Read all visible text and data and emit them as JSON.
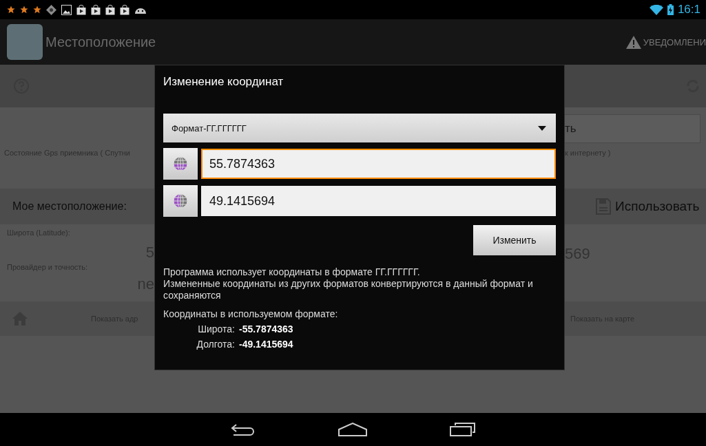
{
  "status_bar": {
    "time": "16:1"
  },
  "action_bar": {
    "title": "Местоположение",
    "notice": "УВЕДОМЛЕНИ"
  },
  "background": {
    "button_fragment": "ть",
    "gps_status_left": "Состояние Gps приемника ( Спутни",
    "gps_status_right": "к интернету )",
    "section_title": "Мое местоположение:",
    "use_button": "Использовать",
    "latitude_label": "Широта (Latitude):",
    "latitude_fragment": "5",
    "longitude_fragment": "569",
    "provider_label": "Провайдер и точность:",
    "provider_fragment": "ne",
    "show_address": "Показать адр",
    "show_on_map": "Показать на карте"
  },
  "dialog": {
    "title": "Изменение координат",
    "format_select": {
      "value": "Формат-ГГ.ГГГГГГ"
    },
    "fields": [
      {
        "value": "55.7874363",
        "focused": true
      },
      {
        "value": "49.1415694",
        "focused": false
      }
    ],
    "apply_button": "Изменить",
    "description": "Программа использует координаты в формате ГГ.ГГГГГГ.\nИзмененные координаты из других форматов конвертируются в данный формат и сохраняются",
    "format_label": "Координаты в используемом формате:",
    "results": [
      {
        "label": "Широта:",
        "value": "-55.7874363"
      },
      {
        "label": "Долгота:",
        "value": "-49.1415694"
      }
    ]
  }
}
